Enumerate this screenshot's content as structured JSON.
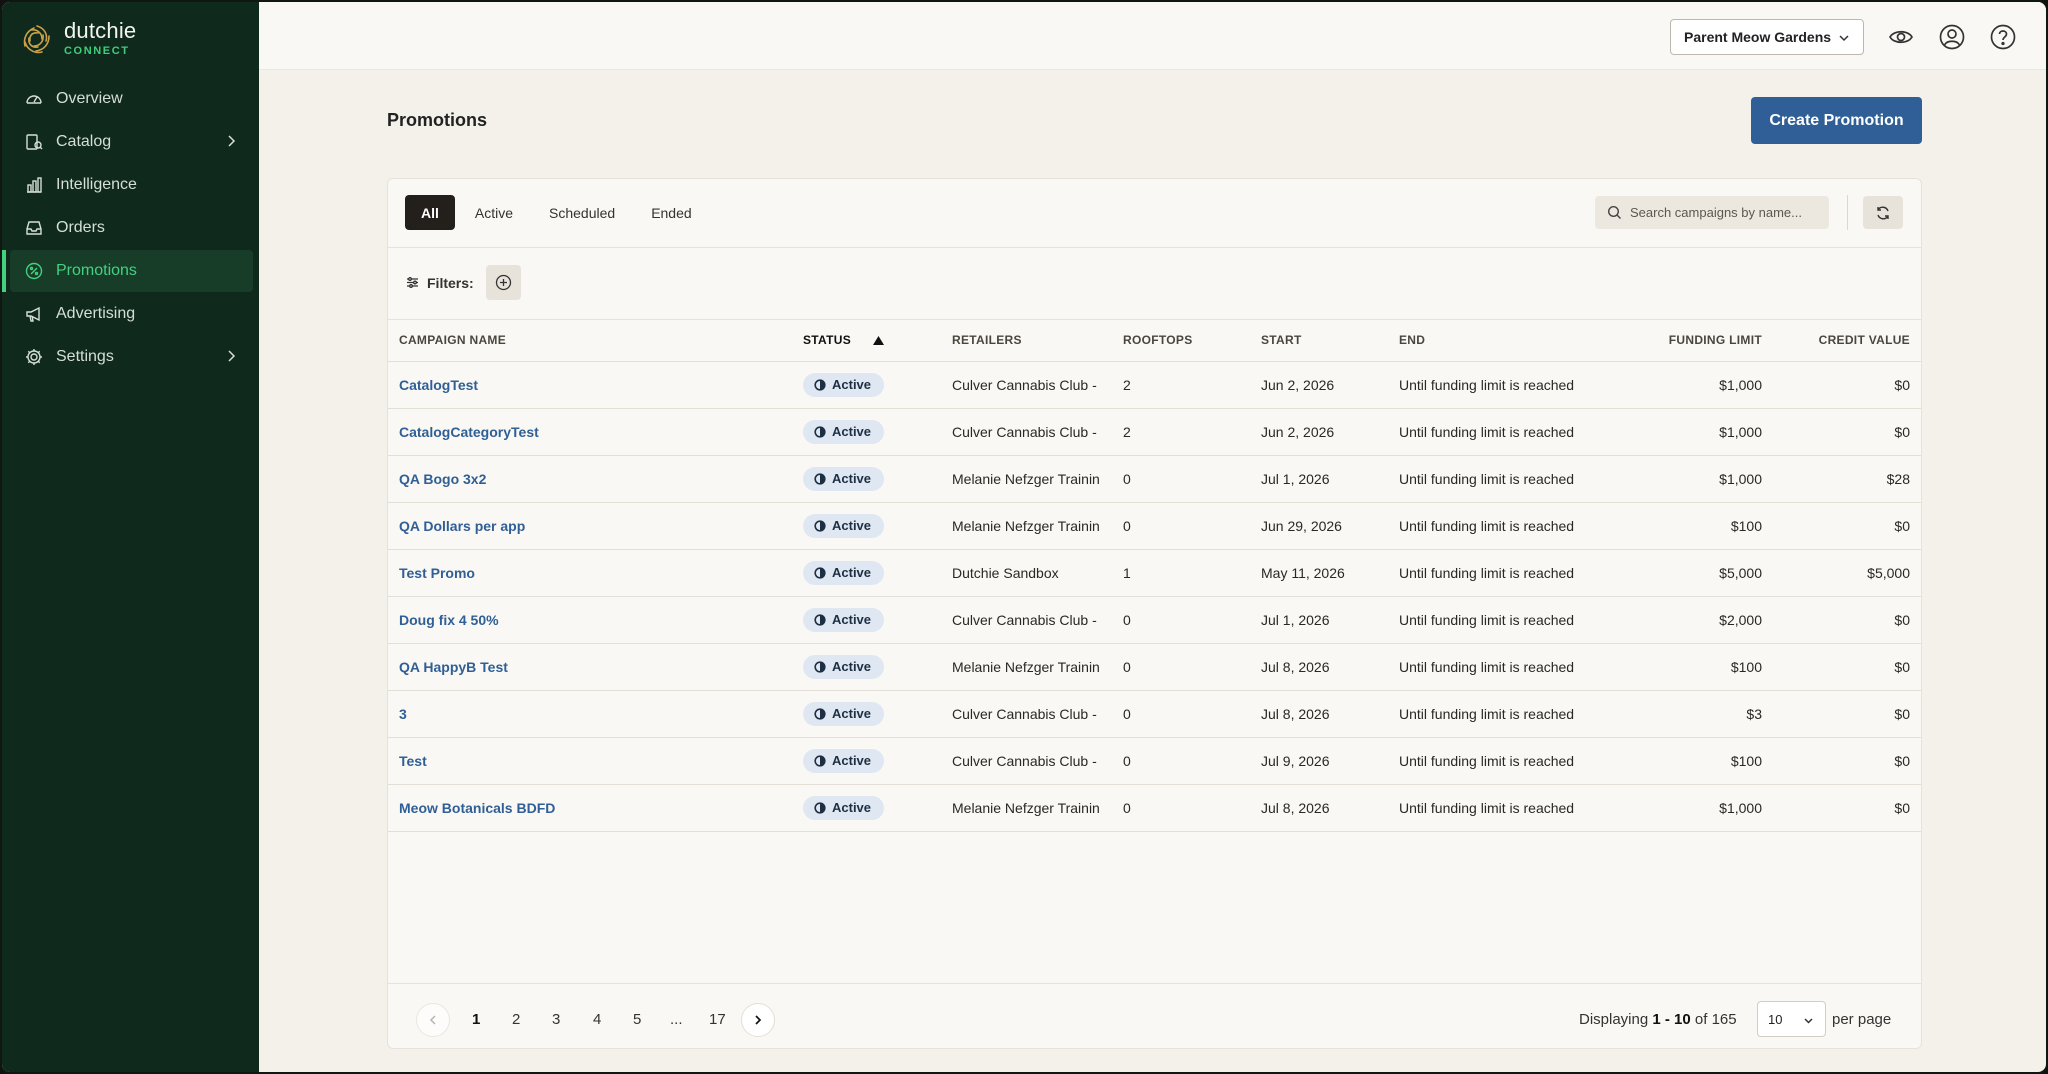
{
  "app": {
    "brand_name": "dutchie",
    "brand_sub": "CONNECT"
  },
  "sidebar": {
    "items": [
      {
        "label": "Overview",
        "icon": "gauge-icon"
      },
      {
        "label": "Catalog",
        "icon": "catalog-icon",
        "has_children": true
      },
      {
        "label": "Intelligence",
        "icon": "bar-chart-icon"
      },
      {
        "label": "Orders",
        "icon": "inbox-icon"
      },
      {
        "label": "Promotions",
        "icon": "percent-badge-icon",
        "active": true
      },
      {
        "label": "Advertising",
        "icon": "megaphone-icon"
      },
      {
        "label": "Settings",
        "icon": "gear-icon",
        "has_children": true
      }
    ]
  },
  "topbar": {
    "account": "Parent Meow Gardens",
    "icons": [
      "eye-icon",
      "user-icon",
      "help-icon"
    ]
  },
  "page": {
    "title": "Promotions",
    "create_button": "Create Promotion"
  },
  "tabs": [
    "All",
    "Active",
    "Scheduled",
    "Ended"
  ],
  "active_tab": "All",
  "search": {
    "placeholder": "Search campaigns by name..."
  },
  "filters": {
    "label": "Filters:"
  },
  "table": {
    "columns": [
      "Campaign Name",
      "Status",
      "Retailers",
      "Rooftops",
      "Start",
      "End",
      "Funding Limit",
      "Credit Value"
    ],
    "sorted_by": "Status",
    "rows": [
      {
        "name": "CatalogTest",
        "status": "Active",
        "retailers": "Culver Cannabis Club -",
        "rooftops": "2",
        "start": "Jun 2, 2026",
        "end": "Until funding limit is reached",
        "funding": "$1,000",
        "credit": "$0"
      },
      {
        "name": "CatalogCategoryTest",
        "status": "Active",
        "retailers": "Culver Cannabis Club -",
        "rooftops": "2",
        "start": "Jun 2, 2026",
        "end": "Until funding limit is reached",
        "funding": "$1,000",
        "credit": "$0"
      },
      {
        "name": "QA Bogo 3x2",
        "status": "Active",
        "retailers": "Melanie Nefzger Trainin",
        "rooftops": "0",
        "start": "Jul 1, 2026",
        "end": "Until funding limit is reached",
        "funding": "$1,000",
        "credit": "$28"
      },
      {
        "name": "QA Dollars per app",
        "status": "Active",
        "retailers": "Melanie Nefzger Trainin",
        "rooftops": "0",
        "start": "Jun 29, 2026",
        "end": "Until funding limit is reached",
        "funding": "$100",
        "credit": "$0"
      },
      {
        "name": "Test Promo",
        "status": "Active",
        "retailers": "Dutchie Sandbox",
        "rooftops": "1",
        "start": "May 11, 2026",
        "end": "Until funding limit is reached",
        "funding": "$5,000",
        "credit": "$5,000"
      },
      {
        "name": "Doug fix 4 50%",
        "status": "Active",
        "retailers": "Culver Cannabis Club -",
        "rooftops": "0",
        "start": "Jul 1, 2026",
        "end": "Until funding limit is reached",
        "funding": "$2,000",
        "credit": "$0"
      },
      {
        "name": "QA HappyB Test",
        "status": "Active",
        "retailers": "Melanie Nefzger Trainin",
        "rooftops": "0",
        "start": "Jul 8, 2026",
        "end": "Until funding limit is reached",
        "funding": "$100",
        "credit": "$0"
      },
      {
        "name": "3",
        "status": "Active",
        "retailers": "Culver Cannabis Club -",
        "rooftops": "0",
        "start": "Jul 8, 2026",
        "end": "Until funding limit is reached",
        "funding": "$3",
        "credit": "$0"
      },
      {
        "name": "Test",
        "status": "Active",
        "retailers": "Culver Cannabis Club -",
        "rooftops": "0",
        "start": "Jul 9, 2026",
        "end": "Until funding limit is reached",
        "funding": "$100",
        "credit": "$0"
      },
      {
        "name": "Meow Botanicals BDFD",
        "status": "Active",
        "retailers": "Melanie Nefzger Trainin",
        "rooftops": "0",
        "start": "Jul 8, 2026",
        "end": "Until funding limit is reached",
        "funding": "$1,000",
        "credit": "$0"
      }
    ]
  },
  "pagination": {
    "pages": [
      "1",
      "2",
      "3",
      "4",
      "5",
      "...",
      "17"
    ],
    "current": "1",
    "display_prefix": "Displaying",
    "display_range": "1 - 10",
    "display_of": "of 165",
    "per_page_value": "10",
    "per_page_label": "per page"
  },
  "colors": {
    "sidebar_bg": "#10291d",
    "accent_green": "#43d17f",
    "primary_blue": "#2f5f96",
    "page_bg": "#f4f1ea"
  }
}
